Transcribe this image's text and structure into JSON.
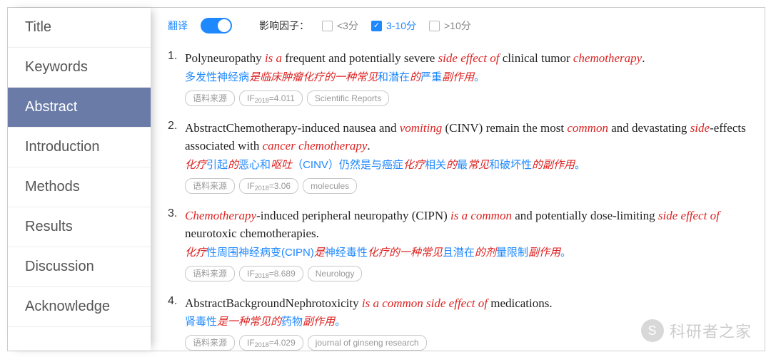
{
  "sidebar": {
    "items": [
      {
        "label": "Title"
      },
      {
        "label": "Keywords"
      },
      {
        "label": "Abstract"
      },
      {
        "label": "Introduction"
      },
      {
        "label": "Methods"
      },
      {
        "label": "Results"
      },
      {
        "label": "Discussion"
      },
      {
        "label": "Acknowledge"
      }
    ],
    "activeIndex": 2
  },
  "filter": {
    "translate_label": "翻译",
    "translate_on": true,
    "impact_label": "影响因子：",
    "options": [
      {
        "label": "<3分",
        "checked": false
      },
      {
        "label": "3-10分",
        "checked": true
      },
      {
        "label": ">10分",
        "checked": false
      }
    ]
  },
  "tag_source_label": "语料来源",
  "entries": [
    {
      "num": "1.",
      "sentence_parts": [
        {
          "t": "Polyneuropathy "
        },
        {
          "t": "is a",
          "hl": true
        },
        {
          "t": " frequent and potentially severe "
        },
        {
          "t": "side effect of",
          "hl": true
        },
        {
          "t": " clinical tumor "
        },
        {
          "t": "chemotherapy",
          "hl": true
        },
        {
          "t": "."
        }
      ],
      "translation_parts": [
        {
          "t": "多发性神经病"
        },
        {
          "t": "是临床肿瘤化疗的一种常见",
          "hl": true
        },
        {
          "t": "和潜在"
        },
        {
          "t": "的",
          "hl": true
        },
        {
          "t": "严重"
        },
        {
          "t": "副作用",
          "hl": true
        },
        {
          "t": "。"
        }
      ],
      "if_tag": "IF2018=4.011",
      "journal": "Scientific Reports"
    },
    {
      "num": "2.",
      "sentence_parts": [
        {
          "t": "AbstractChemotherapy-induced nausea and "
        },
        {
          "t": "vomiting",
          "hl": true
        },
        {
          "t": " (CINV) remain the most "
        },
        {
          "t": "common",
          "hl": true
        },
        {
          "t": " and devastating "
        },
        {
          "t": "side",
          "hl": true
        },
        {
          "t": "-effects associated with "
        },
        {
          "t": "cancer chemotherapy",
          "hl": true
        },
        {
          "t": "."
        }
      ],
      "translation_parts": [
        {
          "t": "化疗",
          "hl": true
        },
        {
          "t": "引起"
        },
        {
          "t": "的",
          "hl": true
        },
        {
          "t": "恶心和"
        },
        {
          "t": "呕吐",
          "hl": true
        },
        {
          "t": "（CINV）仍然是与癌症"
        },
        {
          "t": "化疗",
          "hl": true
        },
        {
          "t": "相关"
        },
        {
          "t": "的",
          "hl": true
        },
        {
          "t": "最"
        },
        {
          "t": "常见",
          "hl": true
        },
        {
          "t": "和破坏性"
        },
        {
          "t": "的副作用",
          "hl": true
        },
        {
          "t": "。"
        }
      ],
      "if_tag": "IF2018=3.06",
      "journal": "molecules"
    },
    {
      "num": "3.",
      "sentence_parts": [
        {
          "t": "Chemotherapy",
          "hl": true
        },
        {
          "t": "-induced peripheral neuropathy (CIPN) "
        },
        {
          "t": "is a common",
          "hl": true
        },
        {
          "t": " and potentially dose-limiting "
        },
        {
          "t": "side effect of",
          "hl": true
        },
        {
          "t": " neurotoxic chemotherapies."
        }
      ],
      "translation_parts": [
        {
          "t": "化疗",
          "hl": true
        },
        {
          "t": "性周围神经病变(CIPN)"
        },
        {
          "t": "是",
          "hl": true
        },
        {
          "t": "神经毒性"
        },
        {
          "t": "化疗的一种常见",
          "hl": true
        },
        {
          "t": "且潜在"
        },
        {
          "t": "的剂",
          "hl": true
        },
        {
          "t": "量限制"
        },
        {
          "t": "副作用",
          "hl": true
        },
        {
          "t": "。"
        }
      ],
      "if_tag": "IF2018=8.689",
      "journal": "Neurology"
    },
    {
      "num": "4.",
      "sentence_parts": [
        {
          "t": "AbstractBackgroundNephrotoxicity "
        },
        {
          "t": "is a common side effect of",
          "hl": true
        },
        {
          "t": " medications."
        }
      ],
      "translation_parts": [
        {
          "t": "肾毒性"
        },
        {
          "t": "是一种常见的",
          "hl": true
        },
        {
          "t": "药物"
        },
        {
          "t": "副作用",
          "hl": true
        },
        {
          "t": "。"
        }
      ],
      "if_tag": "IF2018=4.029",
      "journal": "journal of ginseng research"
    }
  ],
  "watermark": {
    "text": "科研者之家",
    "icon_glyph": "S"
  }
}
